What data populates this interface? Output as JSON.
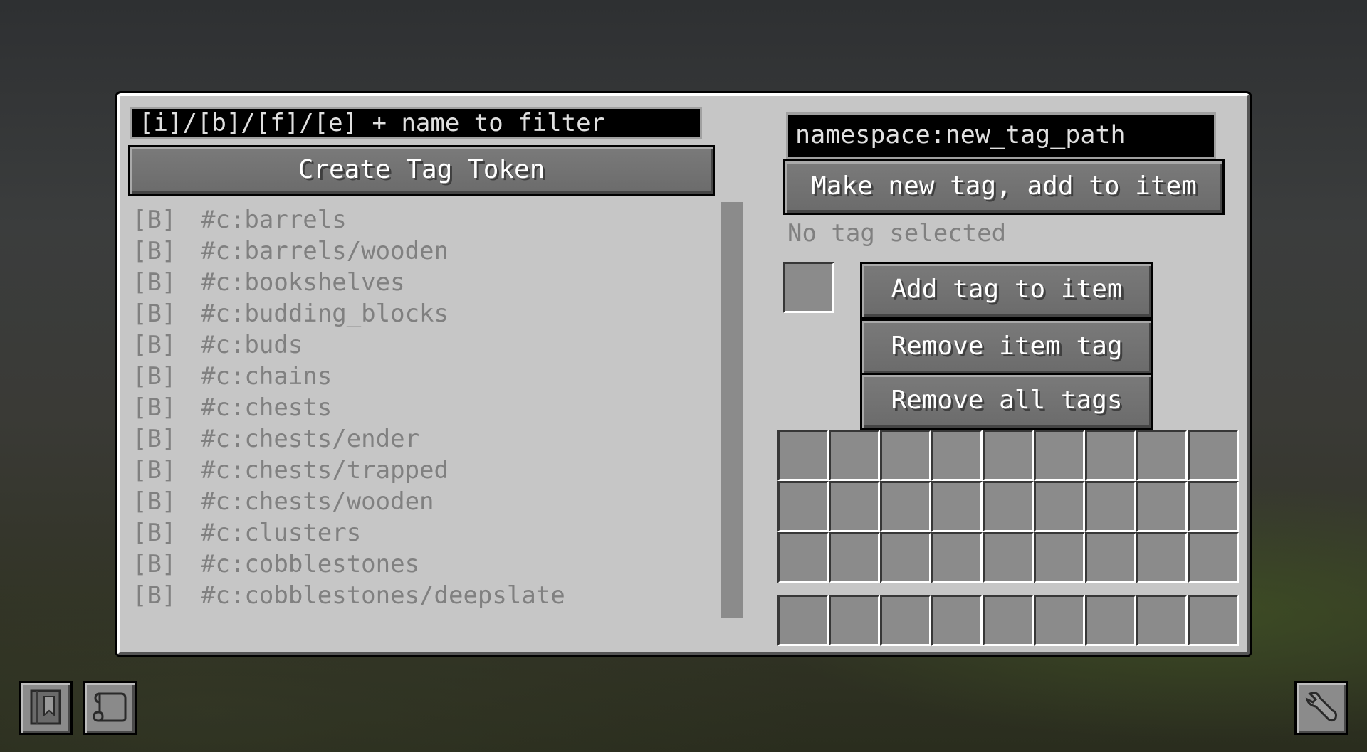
{
  "left_panel": {
    "filter_placeholder": "[i]/[b]/[f]/[e] + name to filter",
    "create_button_label": "Create Tag Token",
    "tags": [
      {
        "type": "[B]",
        "name": "#c:barrels"
      },
      {
        "type": "[B]",
        "name": "#c:barrels/wooden"
      },
      {
        "type": "[B]",
        "name": "#c:bookshelves"
      },
      {
        "type": "[B]",
        "name": "#c:budding_blocks"
      },
      {
        "type": "[B]",
        "name": "#c:buds"
      },
      {
        "type": "[B]",
        "name": "#c:chains"
      },
      {
        "type": "[B]",
        "name": "#c:chests"
      },
      {
        "type": "[B]",
        "name": "#c:chests/ender"
      },
      {
        "type": "[B]",
        "name": "#c:chests/trapped"
      },
      {
        "type": "[B]",
        "name": "#c:chests/wooden"
      },
      {
        "type": "[B]",
        "name": "#c:clusters"
      },
      {
        "type": "[B]",
        "name": "#c:cobblestones"
      },
      {
        "type": "[B]",
        "name": "#c:cobblestones/deepslate"
      }
    ]
  },
  "right_panel": {
    "new_tag_value": "namespace:new_tag_path",
    "make_new_tag_label": "Make new tag, add to item",
    "status_text": "No tag selected",
    "add_tag_label": "Add tag to item",
    "remove_tag_label": "Remove item tag",
    "remove_all_label": "Remove all tags"
  },
  "icons": {
    "bottom_left_1": "tag-book-icon",
    "bottom_left_2": "scroll-icon",
    "bottom_right": "wrench-icon"
  }
}
